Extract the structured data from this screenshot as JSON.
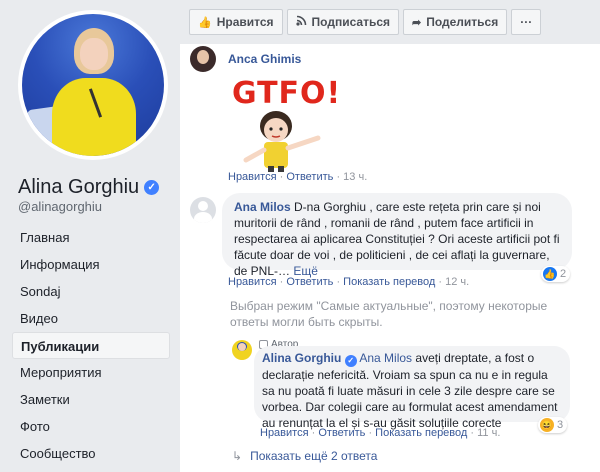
{
  "profile": {
    "name": "Alina Gorghiu",
    "handle": "@alinagorghiu"
  },
  "nav": {
    "items": [
      {
        "label": "Главная"
      },
      {
        "label": "Информация"
      },
      {
        "label": "Sondaj"
      },
      {
        "label": "Видео"
      },
      {
        "label": "Публикации",
        "active": true
      },
      {
        "label": "Мероприятия"
      },
      {
        "label": "Заметки"
      },
      {
        "label": "Фото"
      },
      {
        "label": "Сообщество"
      }
    ]
  },
  "actions": {
    "like": "Нравится",
    "follow": "Подписаться",
    "share": "Поделиться",
    "more": "···"
  },
  "comments": [
    {
      "author": "Anca Ghimis",
      "sticker_text": "GTFO!",
      "actions": {
        "like": "Нравится",
        "reply": "Ответить",
        "time": "13 ч."
      }
    },
    {
      "author": "Ana Milos",
      "text": "D-na Gorghiu , care este rețeta prin care și noi muritorii de rând , romanii de rând , putem face artificii in respectarea ai aplicarea Constituției ? Ori aceste artificii pot fi făcute doar de voi , de politicieni , de cei aflați la guvernare, de PNL-…",
      "see_more": "Ещё",
      "reaction_count": "2",
      "actions": {
        "like": "Нравится",
        "reply": "Ответить",
        "translate": "Показать перевод",
        "time": "12 ч."
      }
    }
  ],
  "notice": "Выбран режим \"Самые актуальные\", поэтому некоторые ответы могли быть скрыты.",
  "reply": {
    "badge": "Автор",
    "author": "Alina Gorghiu",
    "mention": "Ana Milos",
    "text": "aveți dreptate, a fost o declarație nefericită. Vroiam sa spun ca nu e in regula sa nu poată fi luate măsuri in cele 3 zile despre care se vorbea. Dar colegii care au formulat acest amendament au renunțat la el și s-au găsit soluțiile corecte",
    "reaction_count": "3",
    "actions": {
      "like": "Нравится",
      "reply": "Ответить",
      "translate": "Показать перевод",
      "time": "11 ч."
    }
  },
  "more_replies": "Показать ещё 2 ответа",
  "colors": {
    "link": "#385898",
    "verified": "#4080ff",
    "like": "#1877f2",
    "haha": "#f7b125"
  }
}
